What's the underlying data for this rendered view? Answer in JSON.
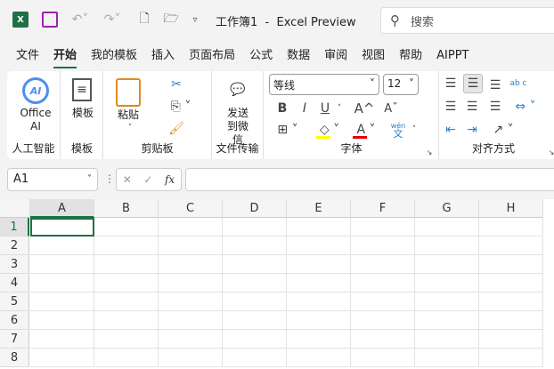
{
  "titlebar": {
    "title": "工作簿1  -  Excel Preview",
    "search_placeholder": "搜索"
  },
  "tabs": [
    {
      "label": "文件"
    },
    {
      "label": "开始",
      "active": true
    },
    {
      "label": "我的模板"
    },
    {
      "label": "插入"
    },
    {
      "label": "页面布局"
    },
    {
      "label": "公式"
    },
    {
      "label": "数据"
    },
    {
      "label": "审阅"
    },
    {
      "label": "视图"
    },
    {
      "label": "帮助"
    },
    {
      "label": "AIPPT"
    }
  ],
  "ribbon": {
    "ai": {
      "button": "Office AI",
      "group": "人工智能",
      "icon_text": "AI"
    },
    "template": {
      "button": "模板",
      "group": "模板"
    },
    "clipboard": {
      "paste": "粘贴",
      "group": "剪贴板"
    },
    "transfer": {
      "button": "发送到微信",
      "group": "文件传输"
    },
    "font": {
      "name": "等线",
      "size": "12",
      "bold": "B",
      "italic": "I",
      "underline": "U",
      "grow": "A^",
      "shrink": "Aˇ",
      "font_color": "A",
      "phonetic_top": "wén",
      "phonetic_bottom": "文",
      "group": "字体",
      "fill_color": "#ffff00",
      "text_color": "#e00000"
    },
    "align": {
      "group": "对齐方式",
      "wrap": "ab c"
    }
  },
  "formula_bar": {
    "name_box": "A1",
    "fx": "fx",
    "formula": ""
  },
  "grid": {
    "columns": [
      "A",
      "B",
      "C",
      "D",
      "E",
      "F",
      "G",
      "H"
    ],
    "rows": [
      "1",
      "2",
      "3",
      "4",
      "5",
      "6",
      "7",
      "8"
    ],
    "selected_cell": "A1"
  }
}
